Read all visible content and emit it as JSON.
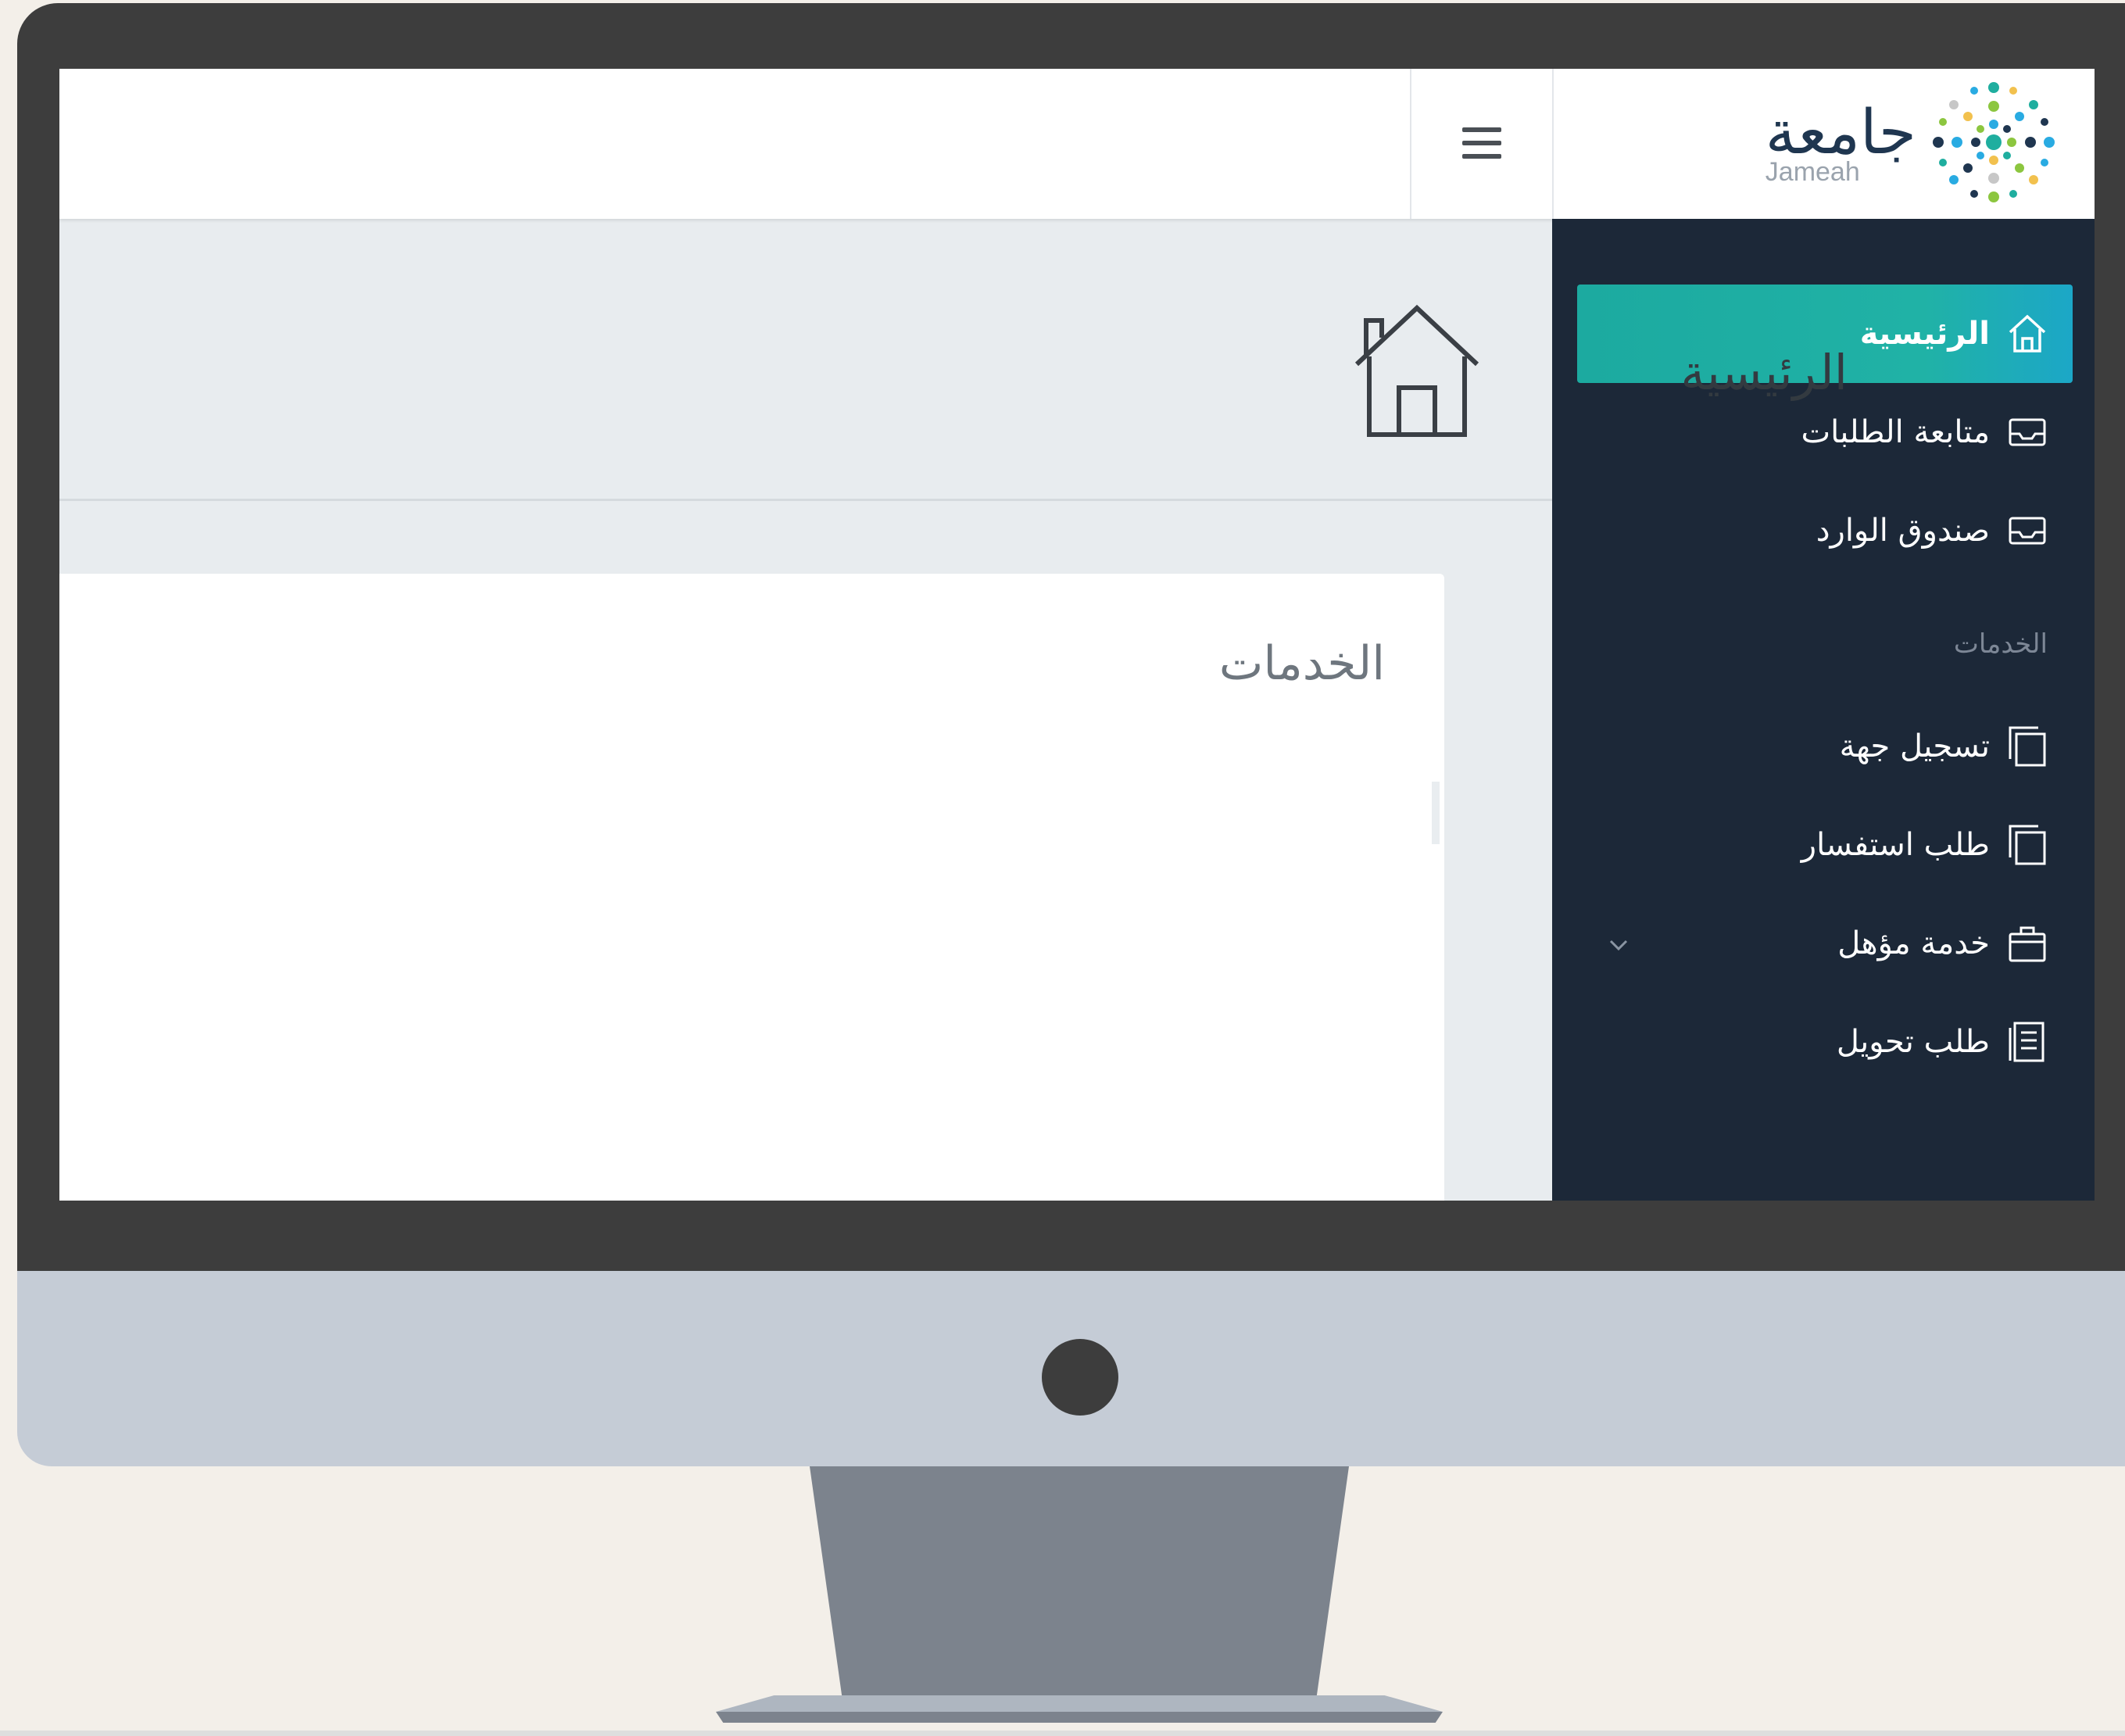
{
  "brand": {
    "name_arabic": "جامعة",
    "name_latin": "Jameah",
    "colors": {
      "accent": "#1fae9f",
      "sidebar_bg": "#1c2838",
      "navy": "#1f3650"
    }
  },
  "topbar": {
    "menu_icon": "hamburger-icon"
  },
  "sidebar": {
    "items": [
      {
        "label": "الرئيسية",
        "icon": "home-icon",
        "active": true
      },
      {
        "label": "متابعة الطلبات",
        "icon": "inbox-icon"
      },
      {
        "label": "صندوق الوارد",
        "icon": "inbox-icon"
      }
    ],
    "section_label": "الخدمات",
    "services": [
      {
        "label": "تسجيل جهة",
        "icon": "copy-icon"
      },
      {
        "label": "طلب استفسار",
        "icon": "copy-icon"
      },
      {
        "label": "خدمة مؤهل",
        "icon": "briefcase-icon",
        "has_submenu": true
      },
      {
        "label": "طلب تحويل",
        "icon": "document-list-icon"
      }
    ]
  },
  "page": {
    "title": "الرئيسية",
    "icon": "house-icon",
    "card_title": "الخدمات"
  }
}
